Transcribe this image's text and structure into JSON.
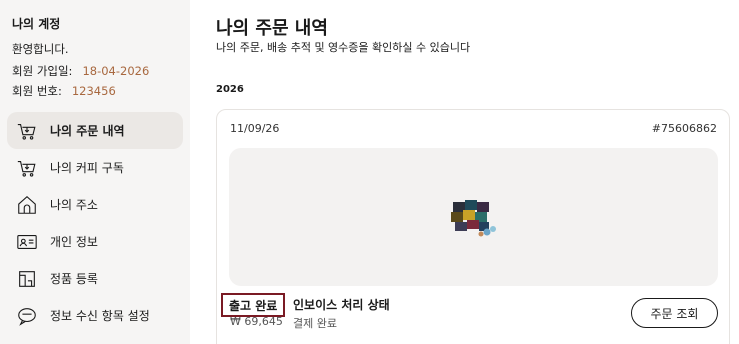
{
  "sidebar": {
    "title": "나의 계정",
    "welcome": "환영합니다.",
    "join_label": "회원 가입일:",
    "join_value": "18-04-2026",
    "member_label": "회원 번호:",
    "member_value": "123456",
    "items": [
      {
        "label": "나의 주문 내역",
        "icon": "cart-icon",
        "active": true
      },
      {
        "label": "나의 커피 구독",
        "icon": "cart-icon",
        "active": false
      },
      {
        "label": "나의 주소",
        "icon": "home-icon",
        "active": false
      },
      {
        "label": "개인 정보",
        "icon": "id-card-icon",
        "active": false
      },
      {
        "label": "정품 등록",
        "icon": "machine-icon",
        "active": false
      },
      {
        "label": "정보 수신 항목 설정",
        "icon": "chat-icon",
        "active": false
      }
    ]
  },
  "main": {
    "title": "나의 주문 내역",
    "subtitle": "나의 주문, 배송 추적 및 영수증을 확인하실 수 있습니다",
    "year": "2026",
    "order": {
      "date": "11/09/26",
      "number": "#75606862",
      "status": "출고 완료",
      "invoice_status": "인보이스 처리 상태",
      "price": "₩ 69,645",
      "payment": "결제 완료",
      "button": "주문 조회",
      "image_alt": "coffee-capsules-product-icon"
    }
  },
  "colors": {
    "accent": "#a8683f",
    "status_border": "#7a1a24",
    "sidebar_bg": "#f6f5f4"
  }
}
